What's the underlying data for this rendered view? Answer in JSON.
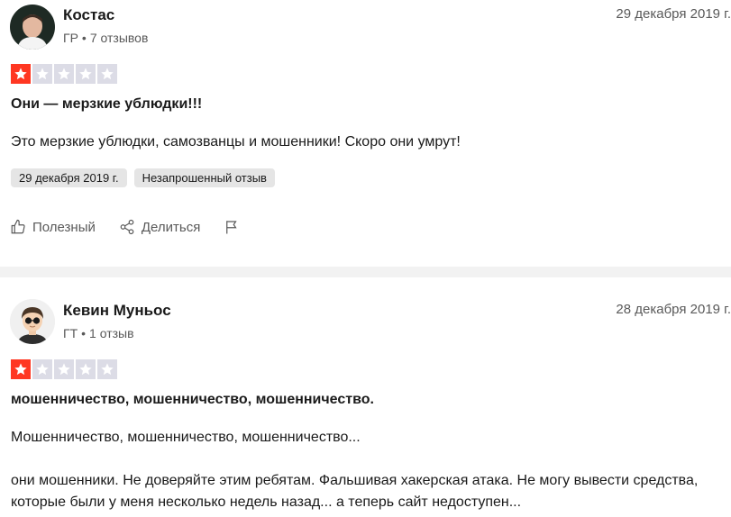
{
  "reviews": [
    {
      "name": "Костас",
      "country": "ГР",
      "review_count": "7 отзывов",
      "date": "29 декабря 2019 г.",
      "rating": 1,
      "title": "Они — мерзкие ублюдки!!!",
      "paragraphs": [
        "Это мерзкие ублюдки, самозванцы и мошенники! Скоро они умрут!"
      ],
      "experience_date": "29 декабря 2019 г.",
      "tag": "Незапрошенный отзыв",
      "actions": {
        "useful": "Полезный",
        "share": "Делиться"
      }
    },
    {
      "name": "Кевин Муньос",
      "country": "ГТ",
      "review_count": "1 отзыв",
      "date": "28 декабря 2019 г.",
      "rating": 1,
      "title": "мошенничество, мошенничество, мошенничество.",
      "paragraphs": [
        "Мошенничество, мошенничество, мошенничество...",
        "они мошенники. Не доверяйте этим ребятам. Фальшивая хакерская атака. Не могу вывести средства, которые были у меня несколько недель назад... а теперь сайт недоступен..."
      ]
    }
  ],
  "icons": {
    "useful": "thumbs-up-icon",
    "share": "share-icon",
    "report": "flag-icon",
    "star": "star-icon"
  },
  "colors": {
    "star_on": "#ff3722",
    "star_off": "#dcdce6",
    "chip_bg": "#e5e5e5",
    "muted_text": "#595959"
  }
}
